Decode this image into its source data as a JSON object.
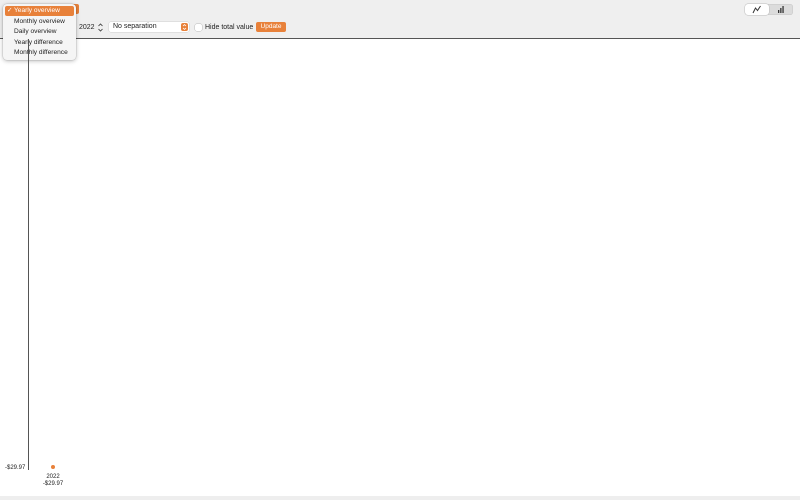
{
  "toolbar": {
    "year": "2022",
    "separation_selected": "No separation",
    "hide_total_label": "Hide total value",
    "update_label": "Update",
    "chart_type_toggle": {
      "options": [
        "line-chart-icon",
        "bar-chart-icon"
      ],
      "selected": "line-chart-icon"
    }
  },
  "overview_menu": {
    "selected": "Yearly overview",
    "items": [
      "Yearly overview",
      "Monthly overview",
      "Daily overview",
      "Yearly difference",
      "Monthly difference"
    ]
  },
  "colors": {
    "accent": "#e8813a",
    "axis": "#555555"
  },
  "chart_data": {
    "type": "line",
    "x": [
      "2022"
    ],
    "series": [
      {
        "values": [
          -29.97
        ],
        "point_labels": [
          "-$29.97"
        ]
      }
    ],
    "y_tick_labels": [
      "-$29.97"
    ],
    "x_tick_labels": [
      "2022"
    ]
  }
}
